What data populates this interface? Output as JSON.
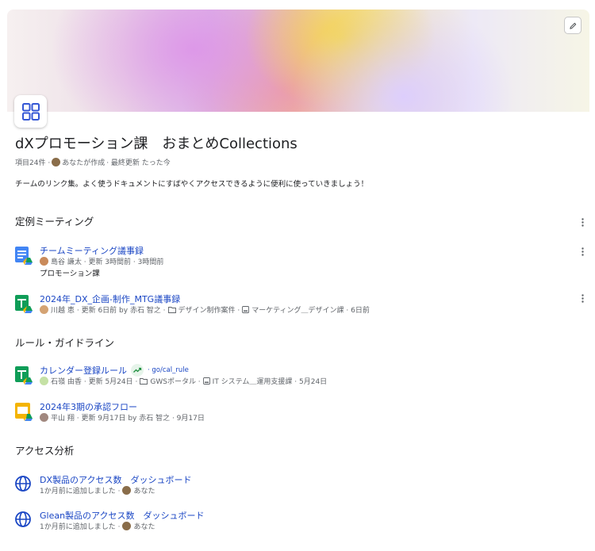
{
  "collection": {
    "title": "dXプロモーション課　おまとめCollections",
    "meta_count": "項目24件 ·",
    "meta_author": "あなたが作成",
    "meta_updated": "· 最終更新 たった今",
    "description": "チームのリンク集。よく使うドキュメントにすばやくアクセスできるように便利に使っていきましょう！"
  },
  "sections": [
    {
      "title": "定例ミーティング",
      "items": [
        {
          "name": "チームミーティング議事録",
          "icon": "google-docs-icon",
          "meta": "島谷 謙太 · 更新 3時間前 · 3時間前",
          "sub": "プロモーション課"
        },
        {
          "name": "2024年_DX_企画-制作_MTG議事録",
          "icon": "google-sheets-icon",
          "meta_person": "川越 恵",
          "meta_updated": "· 更新 6日前 by 赤石 智之 ·",
          "meta_folder": "デザイン制作案件 ·",
          "meta_drive": "マーケティング＿デザイン課 · 6日前"
        }
      ]
    },
    {
      "title": "ルール・ガイドライン",
      "items": [
        {
          "name": "カレンダー登録ルール",
          "icon": "google-sheets-icon",
          "golink": "· go/cal_rule",
          "meta_person": "石嶺 由香",
          "meta_updated": "· 更新 5月24日 ·",
          "meta_folder": "GWSポータル ·",
          "meta_drive": "IT システム＿運用支援課 · 5月24日"
        },
        {
          "name": "2024年3期の承認フロー",
          "icon": "google-slides-icon",
          "meta": "平山 翔 · 更新 9月17日 by 赤石 智之 · 9月17日"
        }
      ]
    },
    {
      "title": "アクセス分析",
      "items": [
        {
          "name": "DX製品のアクセス数　ダッシュボード",
          "icon": "globe-icon",
          "meta_prefix": "1か月前に追加しました ·",
          "meta_user": "あなた"
        },
        {
          "name": "Glean製品のアクセス数　ダッシュボード",
          "icon": "globe-icon",
          "meta_prefix": "1か月前に追加しました ·",
          "meta_user": "あなた"
        }
      ]
    }
  ],
  "colors": {
    "link": "#1a46c4",
    "docs_blue": "#4285f4",
    "sheets_green": "#0f9d58",
    "slides_yellow": "#f4b400"
  }
}
